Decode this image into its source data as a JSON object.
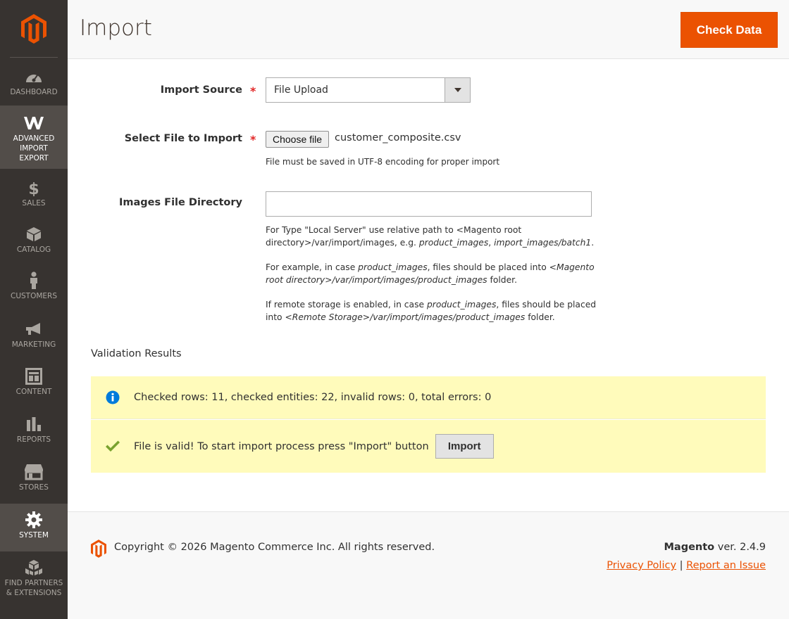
{
  "sidebar": {
    "items": [
      {
        "label": "DASHBOARD",
        "icon": "dashboard-icon"
      },
      {
        "label": "ADVANCED IMPORT EXPORT",
        "icon": "w-logo-icon"
      },
      {
        "label": "SALES",
        "icon": "dollar-icon"
      },
      {
        "label": "CATALOG",
        "icon": "cube-icon"
      },
      {
        "label": "CUSTOMERS",
        "icon": "person-icon"
      },
      {
        "label": "MARKETING",
        "icon": "megaphone-icon"
      },
      {
        "label": "CONTENT",
        "icon": "layout-icon"
      },
      {
        "label": "REPORTS",
        "icon": "bar-chart-icon"
      },
      {
        "label": "STORES",
        "icon": "store-icon"
      },
      {
        "label": "SYSTEM",
        "icon": "gear-icon"
      },
      {
        "label": "FIND PARTNERS & EXTENSIONS",
        "icon": "boxes-icon"
      }
    ],
    "active": [
      "ADVANCED IMPORT EXPORT",
      "SYSTEM"
    ]
  },
  "header": {
    "title": "Import",
    "check_button": "Check Data"
  },
  "form": {
    "import_source": {
      "label": "Import Source",
      "required_mark": "*",
      "value": "File Upload"
    },
    "select_file": {
      "label": "Select File to Import",
      "required_mark": "*",
      "button": "Choose file",
      "file_name": "customer_composite.csv",
      "note": "File must be saved in UTF-8 encoding for proper import"
    },
    "images_dir": {
      "label": "Images File Directory",
      "value": ""
    }
  },
  "validation": {
    "title": "Validation Results",
    "summary": "Checked rows: 11, checked entities: 22, invalid rows: 0, total errors: 0",
    "success": "File is valid! To start import process press \"Import\" button",
    "import_button": "Import"
  },
  "footer": {
    "copyright": "Copyright © 2026 Magento Commerce Inc. All rights reserved.",
    "brand": "Magento",
    "version": " ver. 2.4.9",
    "privacy": "Privacy Policy",
    "separator": "|",
    "report": "Report an Issue"
  },
  "colors": {
    "accent": "#eb5202",
    "sidebar": "#373330",
    "message_bg": "#fffbbb"
  }
}
